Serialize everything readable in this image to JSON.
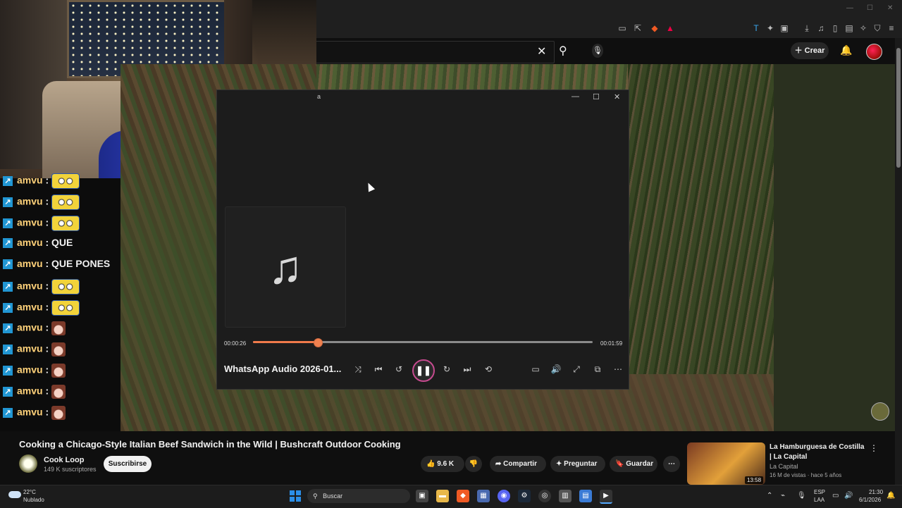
{
  "chat": {
    "messages": [
      {
        "user": "amvu",
        "sep": " : ",
        "text": "",
        "emote": "minion"
      },
      {
        "user": "amvu",
        "sep": " : ",
        "text": "",
        "emote": "minion"
      },
      {
        "user": "amvu",
        "sep": " : ",
        "text": "",
        "emote": "minion"
      },
      {
        "user": "amvu",
        "sep": " : ",
        "text": "QUE",
        "emote": ""
      },
      {
        "user": "amvu",
        "sep": " : ",
        "text": "QUE PONES",
        "emote": ""
      },
      {
        "user": "amvu",
        "sep": " : ",
        "text": "",
        "emote": "minion"
      },
      {
        "user": "amvu",
        "sep": " : ",
        "text": "",
        "emote": "minion"
      },
      {
        "user": "amvu",
        "sep": " : ",
        "text": "",
        "emote": "girl"
      },
      {
        "user": "amvu",
        "sep": " : ",
        "text": "",
        "emote": "girl"
      },
      {
        "user": "amvu",
        "sep": " : ",
        "text": "",
        "emote": "girl"
      },
      {
        "user": "amvu",
        "sep": " : ",
        "text": "",
        "emote": "girl"
      },
      {
        "user": "amvu",
        "sep": " : ",
        "text": "",
        "emote": "girl"
      }
    ]
  },
  "header": {
    "create_label": "Crear"
  },
  "player": {
    "title_fragment": "a",
    "time_current": "00:00:26",
    "time_total": "00:01:59",
    "progress": 0.188,
    "track_name": "WhatsApp Audio 2026-01..."
  },
  "video": {
    "title": "Cooking a Chicago-Style Italian Beef Sandwich in the Wild | Bushcraft Outdoor Cooking",
    "channel": "Cook Loop",
    "subscribers": "149 K suscriptores",
    "subscribe_label": "Suscribirse",
    "likes": "9.6 K",
    "share_label": "Compartir",
    "ask_label": "Preguntar",
    "save_label": "Guardar"
  },
  "recommendation": {
    "title": "La Hamburguesa de Costilla | La Capital",
    "channel": "La Capital",
    "meta": "16 M de vistas · hace 5 años",
    "duration": "13:58"
  },
  "taskbar": {
    "temp": "22°C",
    "weather": "Nublado",
    "search_placeholder": "Buscar",
    "lang1": "ESP",
    "lang2": "LAA",
    "time": "21:30",
    "date": "6/1/2026"
  }
}
